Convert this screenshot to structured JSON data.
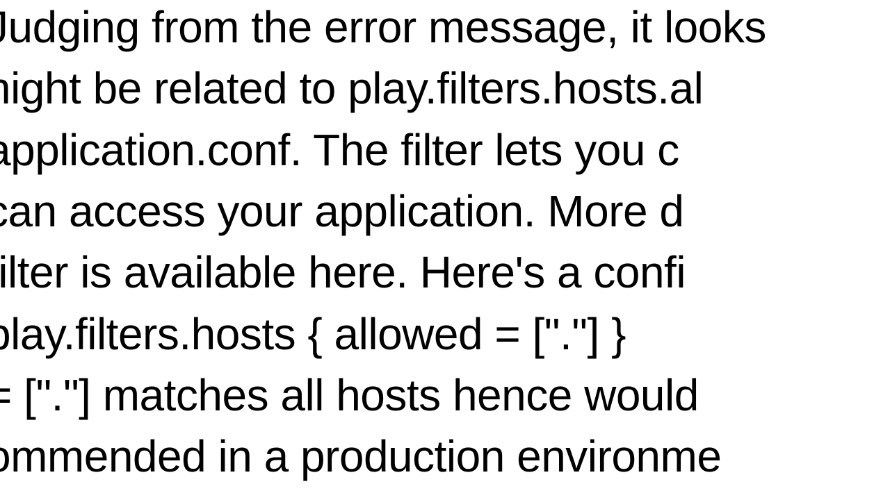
{
  "document": {
    "lines": [
      "Judging from the error message, it looks",
      "night be related to play.filters.hosts.al",
      " application.conf.  The filter lets you c",
      " can access your application.  More d",
      " filter is available here. Here's a confi",
      " play.filters.hosts {   allowed = [\".\"] }",
      " = [\".\"] matches all hosts hence would",
      "ommended in a production environme"
    ]
  }
}
